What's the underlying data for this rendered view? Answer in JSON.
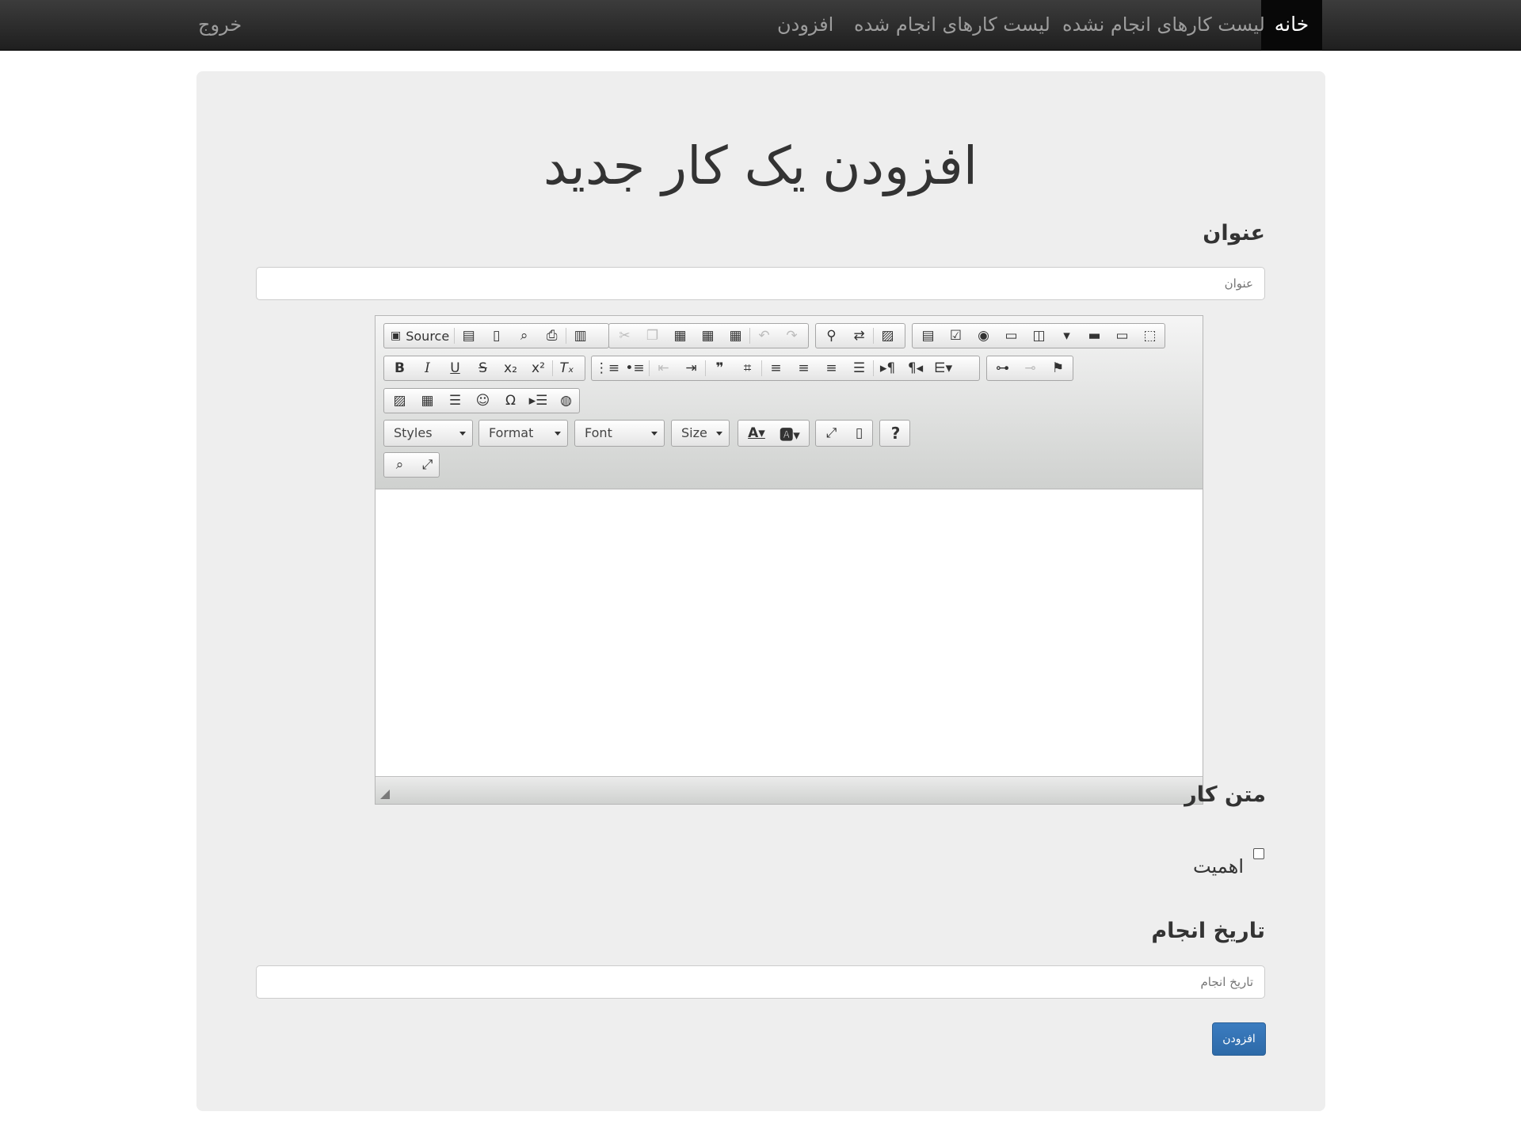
{
  "nav": {
    "home": "خانه",
    "undone_list": "لیست کارهای انجام نشده",
    "done_list": "لیست کارهای انجام شده",
    "add": "افزودن",
    "logout": "خروج"
  },
  "page": {
    "title": "افزودن یک کار جدید"
  },
  "form": {
    "title_label": "عنوان",
    "title_placeholder": "عنوان",
    "body_label": "متن کار",
    "importance_label": "اهمیت",
    "importance_checked": false,
    "date_label": "تاریخ انجام",
    "date_placeholder": "تاریخ انجام",
    "submit_label": "افزودن"
  },
  "editor": {
    "source_label": "Source",
    "styles_label": "Styles",
    "format_label": "Format",
    "font_label": "Font",
    "size_label": "Size",
    "help_label": "?"
  }
}
